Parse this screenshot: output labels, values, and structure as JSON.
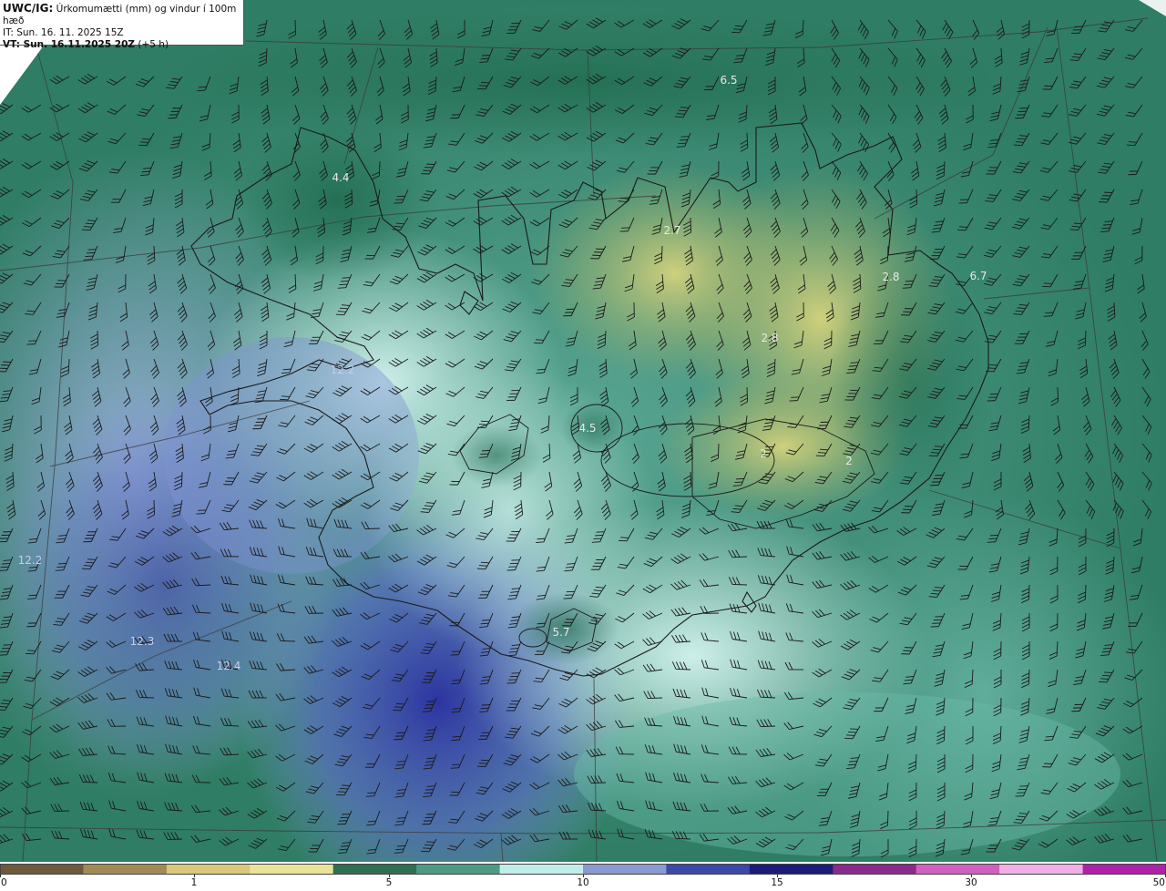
{
  "header": {
    "model": "UWC/IG:",
    "title": "Úrkomumætti (mm) og vindur í 100m hæð",
    "it_line": "IT: Sun. 16. 11. 2025 15Z",
    "vt_label": "VT: Sun. 16.11.2025 20Z",
    "vt_offset": "(+5 h)"
  },
  "map_labels": [
    {
      "id": "label-6-5",
      "text": "6.5"
    },
    {
      "id": "label-4-4",
      "text": "4.4"
    },
    {
      "id": "label-2-7",
      "text": "2.7"
    },
    {
      "id": "label-2-8-east",
      "text": "2.8"
    },
    {
      "id": "label-6-7",
      "text": "6.7"
    },
    {
      "id": "label-2-8-center",
      "text": "2.8"
    },
    {
      "id": "label-12-2-west",
      "text": "12.2"
    },
    {
      "id": "label-4-5",
      "text": "4.5"
    },
    {
      "id": "label-2-south",
      "text": "2"
    },
    {
      "id": "label-2-southeast",
      "text": "2"
    },
    {
      "id": "label-12-2-sw",
      "text": "12.2"
    },
    {
      "id": "label-12-3",
      "text": "12.3"
    },
    {
      "id": "label-12-4",
      "text": "12.4"
    },
    {
      "id": "label-5-7",
      "text": "5.7"
    }
  ],
  "colorbar": {
    "ticks": [
      "0",
      "1",
      "5",
      "10",
      "15",
      "30",
      "50"
    ],
    "colors": [
      "#6b5a3c",
      "#a08a55",
      "#d8c878",
      "#e9e39a",
      "#2e6e52",
      "#4e9a84",
      "#bfeee8",
      "#8a9ad0",
      "#3c48a8",
      "#1d1c78",
      "#8a2a8a",
      "#d060c0",
      "#f0b0e6",
      "#b020a8"
    ]
  },
  "colors": {
    "ocean_green": "#2e7a62",
    "land_yellow": "#c4c874",
    "precip_blue": "#4a5ab8",
    "precip_cyan": "#c2ece8"
  }
}
